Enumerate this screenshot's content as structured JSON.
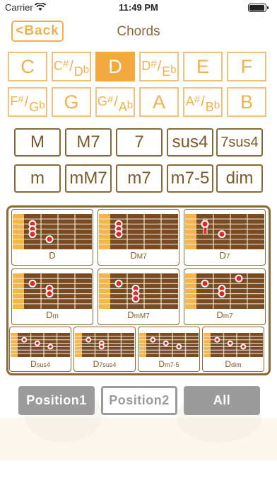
{
  "status_bar": {
    "carrier": "Carrier",
    "time": "11:49 PM",
    "battery_level": 1.0
  },
  "header": {
    "back_label": "<Back",
    "title": "Chords"
  },
  "keys": [
    {
      "id": "C",
      "main": "C",
      "selected": false
    },
    {
      "id": "C#Db",
      "top": "C",
      "sharp": "#",
      "flat_root": "D",
      "flat": "b",
      "selected": false
    },
    {
      "id": "D",
      "main": "D",
      "selected": true
    },
    {
      "id": "D#Eb",
      "top": "D",
      "sharp": "#",
      "flat_root": "E",
      "flat": "b",
      "selected": false
    },
    {
      "id": "E",
      "main": "E",
      "selected": false
    },
    {
      "id": "F",
      "main": "F",
      "selected": false
    },
    {
      "id": "F#Gb",
      "top": "F",
      "sharp": "#",
      "flat_root": "G",
      "flat": "b",
      "selected": false
    },
    {
      "id": "G",
      "main": "G",
      "selected": false
    },
    {
      "id": "G#Ab",
      "top": "G",
      "sharp": "#",
      "flat_root": "A",
      "flat": "b",
      "selected": false
    },
    {
      "id": "A",
      "main": "A",
      "selected": false
    },
    {
      "id": "A#Bb",
      "top": "A",
      "sharp": "#",
      "flat_root": "B",
      "flat": "b",
      "selected": false
    },
    {
      "id": "B",
      "main": "B",
      "selected": false
    }
  ],
  "chord_types": [
    "M",
    "M7",
    "7",
    "sus4",
    "7sus4",
    "m",
    "mM7",
    "m7",
    "m7-5",
    "dim"
  ],
  "diagrams": [
    {
      "root": "D",
      "suffix": "",
      "dots": [
        [
          1,
          2
        ],
        [
          1,
          3
        ],
        [
          1,
          4
        ],
        [
          2,
          5
        ]
      ]
    },
    {
      "root": "D",
      "suffix": "M7",
      "dots": [
        [
          1,
          2
        ],
        [
          1,
          3
        ],
        [
          1,
          4
        ]
      ]
    },
    {
      "root": "D",
      "suffix": "7",
      "dots": [
        [
          1,
          2
        ],
        [
          2,
          4
        ]
      ],
      "barre": true
    },
    {
      "root": "D",
      "suffix": "m",
      "dots": [
        [
          1,
          2
        ],
        [
          2,
          3
        ],
        [
          2,
          4
        ]
      ]
    },
    {
      "root": "D",
      "suffix": "mM7",
      "dots": [
        [
          1,
          2
        ],
        [
          2,
          3
        ],
        [
          2,
          4
        ],
        [
          2,
          5
        ]
      ]
    },
    {
      "root": "D",
      "suffix": "m7",
      "dots": [
        [
          1,
          2
        ],
        [
          2,
          3
        ],
        [
          2,
          4
        ],
        [
          3,
          1
        ]
      ]
    },
    {
      "root": "D",
      "suffix": "sus4",
      "dots": [
        [
          1,
          2
        ],
        [
          2,
          3
        ],
        [
          3,
          4
        ]
      ]
    },
    {
      "root": "D",
      "suffix": "7sus4",
      "dots": [
        [
          1,
          2
        ],
        [
          2,
          3
        ],
        [
          2,
          4
        ]
      ]
    },
    {
      "root": "D",
      "suffix": "m7-5",
      "dots": [
        [
          1,
          2
        ],
        [
          2,
          3
        ],
        [
          3,
          4
        ]
      ]
    },
    {
      "root": "D",
      "suffix": "dim",
      "dots": [
        [
          1,
          2
        ],
        [
          2,
          3
        ],
        [
          3,
          4
        ]
      ]
    }
  ],
  "position_buttons": [
    "Position1",
    "Position2",
    "All"
  ],
  "colors": {
    "accent": "#f2a93d",
    "accent_light": "#f2c07a",
    "brown": "#8a6a3a",
    "fretboard": "#7a4b21",
    "dot": "#e0282a",
    "nut": "#f4b64c",
    "button_gray": "#9b9b9b"
  }
}
